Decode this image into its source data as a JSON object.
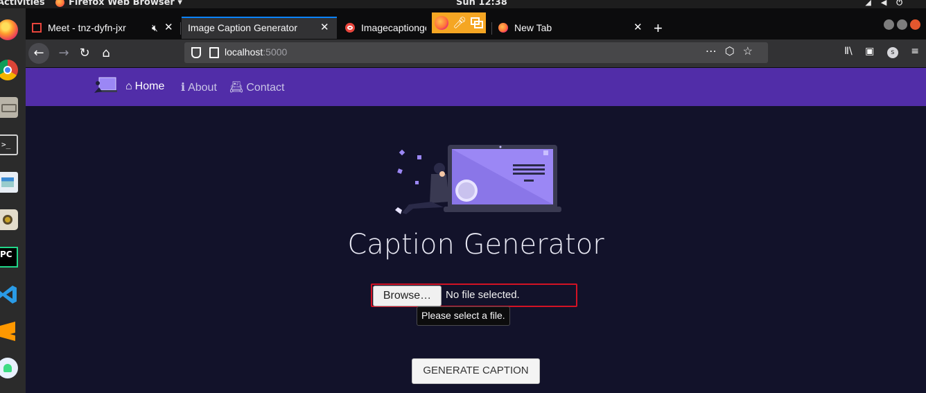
{
  "system": {
    "activities": "Activities",
    "app_menu": "Firefox Web Browser ▾",
    "clock": "Sun 12:38"
  },
  "browser": {
    "tabs": [
      {
        "label": "Meet - tnz-dyfn-jxr",
        "icon": "meet-icon",
        "extra_icon": "camera-off-icon"
      },
      {
        "label": "Image Caption Generator",
        "active": true
      },
      {
        "label": "Imagecaptionge",
        "icon": "red-glasses-icon"
      },
      {
        "label": "New Tab",
        "icon": "firefox-icon"
      }
    ],
    "close_glyph": "✕",
    "new_tab_glyph": "+",
    "url_host": "localhost",
    "url_port": ":5000"
  },
  "site": {
    "nav": [
      {
        "label": "Home",
        "icon": "home-icon"
      },
      {
        "label": "About",
        "icon": "info-icon"
      },
      {
        "label": "Contact",
        "icon": "contact-card-icon"
      }
    ],
    "title": "Caption Generator",
    "browse_label": "Browse…",
    "file_status": "No file selected.",
    "tooltip": "Please select a file.",
    "generate_label": "GENERATE CAPTION"
  },
  "colors": {
    "nav_bg": "#512da8",
    "page_bg": "#12122a",
    "accent": "#0a84ff",
    "error_border": "#d41224",
    "illustration_purple": "#9b87f5"
  }
}
